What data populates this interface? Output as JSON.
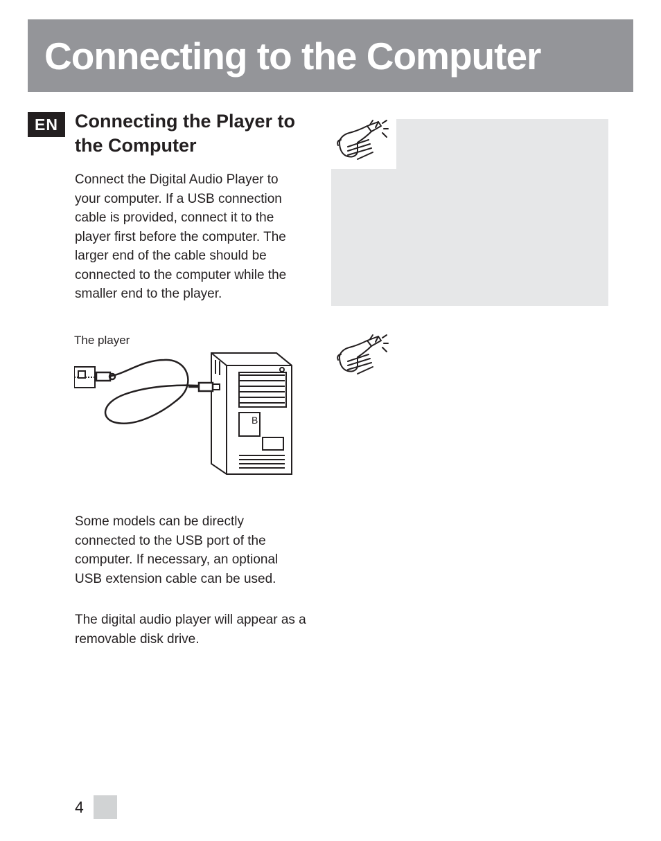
{
  "titleBanner": "Connecting to the Computer",
  "langBadge": "EN",
  "sectionHeading": "Connecting the Player to the Computer",
  "body1": "Connect the Digital Audio Player to your computer. If a USB connection cable is provided, connect it to the player first before the computer. The larger end of the cable should be connected to the computer while the smaller end to the player.",
  "figCaption": "The player",
  "body2": "Some models can be directly connected to the USB port of the computer. If necessary, an optional USB extension cable can be used.",
  "body3": "The digital audio player will appear as a removable disk drive.",
  "pageNumber": "4"
}
